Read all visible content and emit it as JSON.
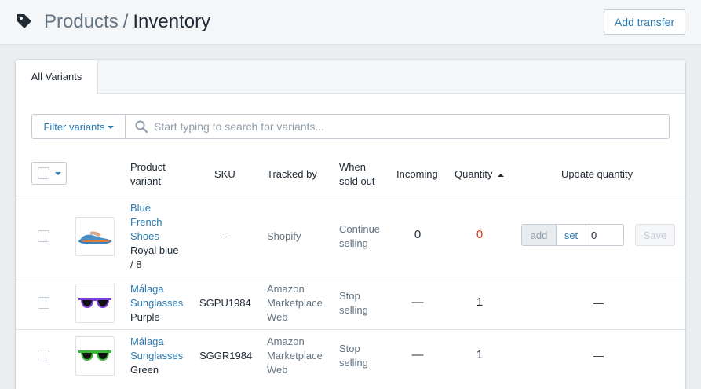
{
  "header": {
    "breadcrumb_parent": "Products",
    "breadcrumb_separator": "/",
    "title": "Inventory",
    "add_transfer_label": "Add transfer",
    "icon": "tag-icon"
  },
  "tabs": [
    {
      "label": "All Variants",
      "active": true
    }
  ],
  "filter": {
    "label": "Filter variants",
    "search_placeholder": "Start typing to search for variants..."
  },
  "columns": {
    "product_variant_1": "Product",
    "product_variant_2": "variant",
    "sku": "SKU",
    "tracked_by": "Tracked by",
    "when_sold_out_1": "When",
    "when_sold_out_2": "sold out",
    "incoming": "Incoming",
    "quantity": "Quantity",
    "update_quantity": "Update quantity"
  },
  "rows": [
    {
      "product_lines": [
        "Blue",
        "French",
        "Shoes"
      ],
      "variant_lines": [
        "Royal blue",
        "/ 8"
      ],
      "sku": "—",
      "tracked_by_lines": [
        "Shopify"
      ],
      "sold_out_lines": [
        "Continue",
        "selling"
      ],
      "incoming": "0",
      "quantity": "0",
      "update": {
        "add_label": "add",
        "set_label": "set",
        "value": "0",
        "save_label": "Save"
      }
    },
    {
      "product_lines": [
        "Málaga",
        "Sunglasses"
      ],
      "variant_lines": [
        "Purple"
      ],
      "sku": "SGPU1984",
      "tracked_by_lines": [
        "Amazon",
        "Marketplace",
        "Web"
      ],
      "sold_out_lines": [
        "Stop",
        "selling"
      ],
      "incoming": "—",
      "quantity": "1",
      "update_placeholder": "—"
    },
    {
      "product_lines": [
        "Málaga",
        "Sunglasses"
      ],
      "variant_lines": [
        "Green"
      ],
      "sku": "SGGR1984",
      "tracked_by_lines": [
        "Amazon",
        "Marketplace",
        "Web"
      ],
      "sold_out_lines": [
        "Stop",
        "selling"
      ],
      "incoming": "—",
      "quantity": "1",
      "update_placeholder": "—"
    }
  ],
  "colors": {
    "link": "#2b7ab0",
    "zero_quantity": "#de3618",
    "purple_frame": "#7a3fd6",
    "green_frame": "#3bb83b",
    "shoe_blue": "#3a7fb8"
  }
}
